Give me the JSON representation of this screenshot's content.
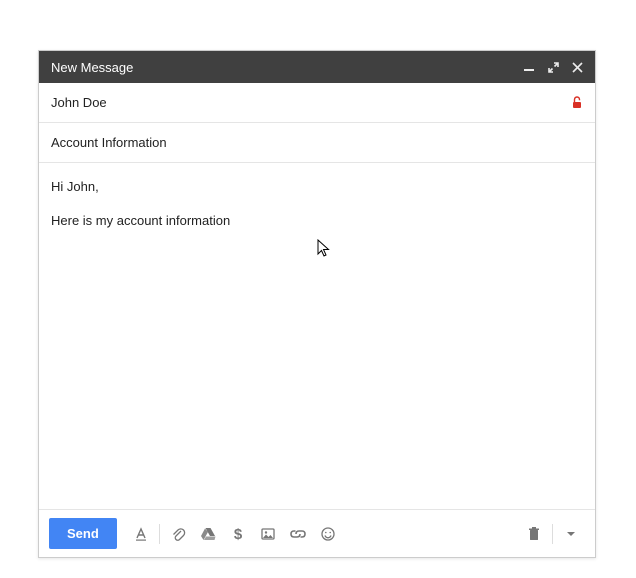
{
  "header": {
    "title": "New Message"
  },
  "recipient": "John Doe",
  "subject": "Account Information",
  "body": {
    "line1": "Hi John,",
    "line2": "Here is my account information"
  },
  "toolbar": {
    "send_label": "Send"
  }
}
